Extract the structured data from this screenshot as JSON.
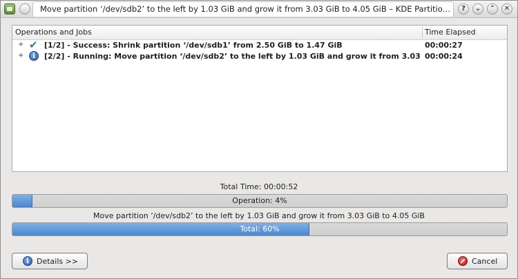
{
  "window": {
    "title": "Move partition ‘/dev/sdb2’ to the left by 1.03 GiB and grow it from 3.03 GiB to 4.05 GiB – KDE Partitio…"
  },
  "titlebar_buttons": {
    "help": "?",
    "minimize": "⌄",
    "maximize": "⌃",
    "close": "✕"
  },
  "jobs": {
    "columns": [
      "Operations and Jobs",
      "Time Elapsed"
    ],
    "rows": [
      {
        "expander": "+",
        "icon": "check-icon",
        "text": "[1/2] - Success: Shrink partition ‘/dev/sdb1’ from 2.50 GiB to 1.47 GiB",
        "time": "00:00:27"
      },
      {
        "expander": "+",
        "icon": "info-icon",
        "text": "[2/2] - Running: Move partition ‘/dev/sdb2’ to the left by 1.03 GiB and grow it from 3.03…",
        "time": "00:00:24"
      }
    ]
  },
  "total_time": "Total Time: 00:00:52",
  "operation_progress": {
    "label": "Operation: 4%",
    "value": 4
  },
  "operation_name": "Move partition ‘/dev/sdb2’ to the left by 1.03 GiB and grow it from 3.03 GiB to 4.05 GiB",
  "total_progress": {
    "label": "Total: 60%",
    "value": 60
  },
  "buttons": {
    "details": "Details >>",
    "cancel": "Cancel"
  }
}
